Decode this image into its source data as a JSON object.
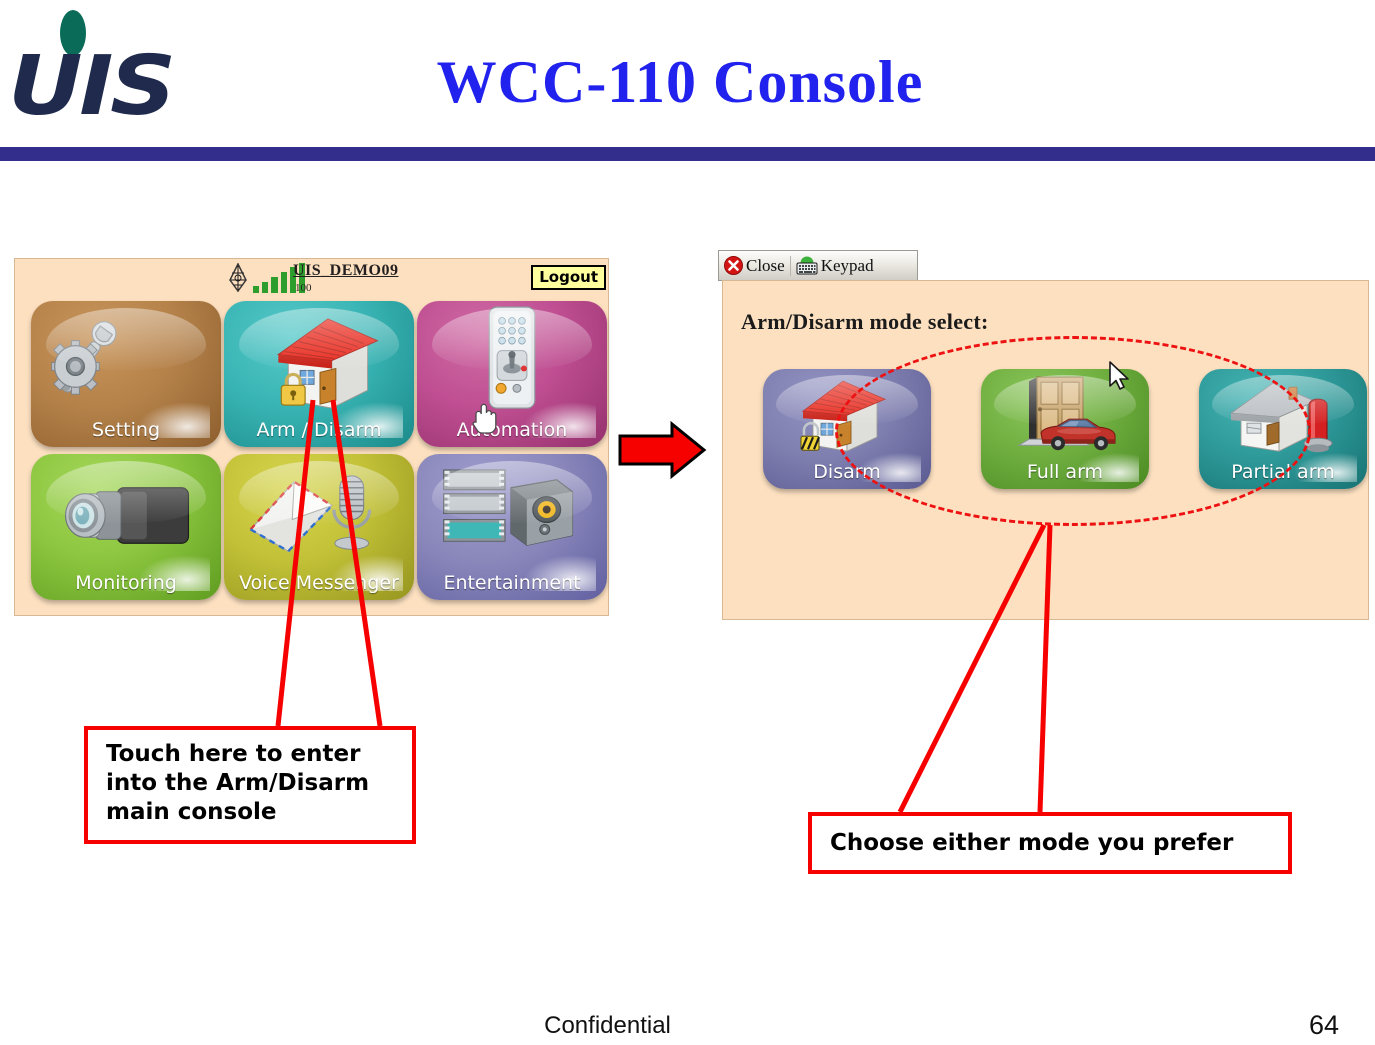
{
  "header": {
    "logo_text": "UIS",
    "title": "WCC-110 Console"
  },
  "left_console": {
    "status": {
      "antenna_icon": "antenna-icon",
      "signal_icon": "signal-bars-icon",
      "signal_bars": [
        7,
        11,
        16,
        21,
        26,
        30
      ],
      "device_name": "UIS_DEMO09",
      "device_id": "100",
      "logout_label": "Logout"
    },
    "tiles": [
      {
        "label": "Setting",
        "icon": "wrench-gear-icon",
        "color": "#b5824a",
        "color2": "#8d5e2d"
      },
      {
        "label": "Arm / Disarm",
        "icon": "house-padlock-icon",
        "color": "#39b4b4",
        "color2": "#1b8a8a"
      },
      {
        "label": "Automation",
        "icon": "remote-control-icon",
        "color": "#bf4f92",
        "color2": "#95306d"
      },
      {
        "label": "Monitoring",
        "icon": "video-camera-icon",
        "color": "#8cc63f",
        "color2": "#5f9c20"
      },
      {
        "label": "Voice Messenger",
        "icon": "envelope-microphone-icon",
        "color": "#c2c137",
        "color2": "#96951f"
      },
      {
        "label": "Entertainment",
        "icon": "film-projector-icon",
        "color": "#8a88bb",
        "color2": "#615fa0"
      }
    ]
  },
  "right_console": {
    "toolbar": {
      "close_label": "Close",
      "close_icon": "close-circle-icon",
      "keypad_label": "Keypad",
      "keypad_icon": "keypad-icon"
    },
    "heading": "Arm/Disarm mode select:",
    "tiles": [
      {
        "label": "Disarm",
        "icon": "house-open-padlock-icon",
        "color": "#7f7fb0",
        "color2": "#5a5a92"
      },
      {
        "label": "Full arm",
        "icon": "door-car-icon",
        "color": "#6fae3f",
        "color2": "#4a8a22"
      },
      {
        "label": "Partial arm",
        "icon": "house-siren-icon",
        "color": "#2f9a9a",
        "color2": "#177272"
      }
    ],
    "highlight_shape": "dashed-ellipse"
  },
  "annotations": {
    "flow_arrow_icon": "right-arrow-icon",
    "callout_left": "Touch here to enter into the Arm/Disarm main console",
    "callout_left_lines": [
      "Touch here to enter",
      "into the Arm/Disarm",
      "main console"
    ],
    "callout_right": "Choose either mode you prefer",
    "cursor_left_icon": "hand-pointer-cursor",
    "cursor_right_icon": "arrow-cursor"
  },
  "footer": {
    "confidential": "Confidential",
    "page_number": "64"
  },
  "colors": {
    "title_blue": "#2222ee",
    "rule_navy": "#332e8c",
    "panel_peach": "#fce0c0",
    "annotation_red": "#f60000",
    "logo_navy": "#1f2a4d",
    "logo_green": "#0a6c58",
    "logout_yellow": "#ffff9e"
  }
}
